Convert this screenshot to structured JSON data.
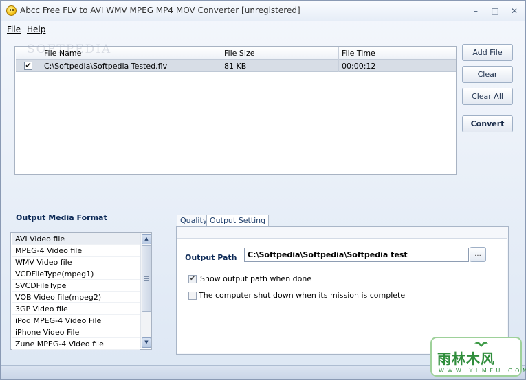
{
  "window": {
    "title": "Abcc Free FLV to AVI WMV MPEG MP4 MOV Converter  [unregistered]",
    "controls": {
      "minimize": "–",
      "maximize": "□",
      "close": "✕"
    }
  },
  "menu": {
    "file": "File",
    "help": "Help"
  },
  "file_list": {
    "columns": [
      "File Name",
      "File Size",
      "File Time"
    ],
    "rows": [
      {
        "checked": true,
        "name": "C:\\Softpedia\\Softpedia Tested.flv",
        "size": "81 KB",
        "time": "00:00:12"
      }
    ]
  },
  "side_buttons": {
    "add_file": "Add File",
    "clear": "Clear",
    "clear_all": "Clear All",
    "convert": "Convert"
  },
  "output_media_format": {
    "title": "Output Media Format",
    "items": [
      "AVI Video file",
      "MPEG-4 Video file",
      "WMV Video file",
      "VCDFileType(mpeg1)",
      "SVCDFileType",
      "VOB Video file(mpeg2)",
      "3GP Video file",
      "iPod MPEG-4 Video File",
      "iPhone Video File",
      "Zune MPEG-4 Video file"
    ],
    "selected": "AVI Video file"
  },
  "tabs": {
    "quality": "Quality",
    "output_setting": "Output Setting",
    "active": "Output Setting"
  },
  "output": {
    "path_label": "Output Path",
    "path_value": "C:\\Softpedia\\Softpedia\\Softpedia test",
    "browse_label": "...",
    "show_path_label": "Show output path when done",
    "show_path_checked": true,
    "shutdown_label": "The computer shut down when its mission is complete",
    "shutdown_checked": false
  },
  "watermarks": {
    "softpedia": "SOFTPEDIA",
    "logo_main": "雨林木风",
    "logo_url": "W W W . Y L M F U . C O M"
  },
  "colors": {
    "accent": "#0d2a57",
    "logo_green": "#2f8d3b",
    "selection": "#d7dde6"
  },
  "icons": {
    "title": "smiley-icon",
    "checkmark": "check-icon",
    "scroll_up": "arrow-up-icon",
    "scroll_down": "arrow-down-icon"
  }
}
